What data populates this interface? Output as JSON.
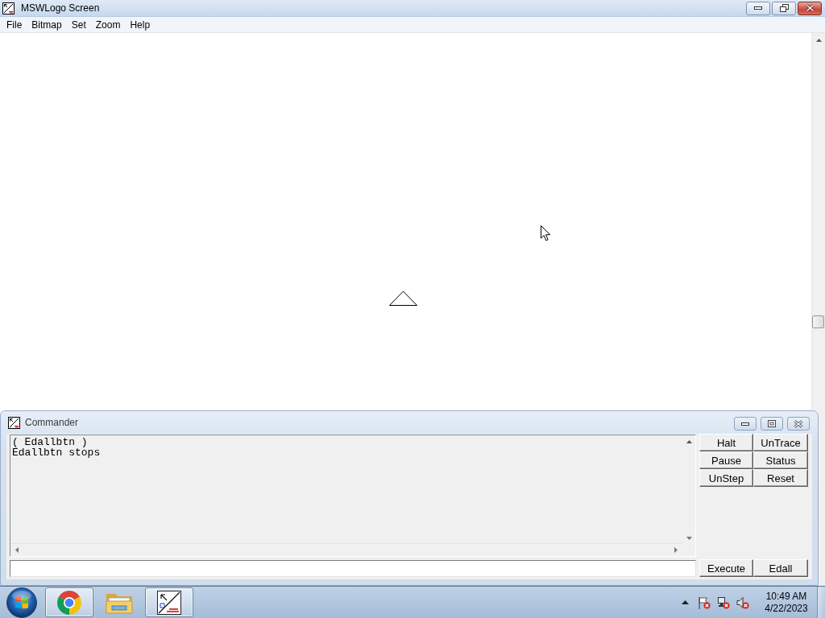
{
  "window": {
    "title": "MSWLogo Screen"
  },
  "menu": [
    "File",
    "Bitmap",
    "Set",
    "Zoom",
    "Help"
  ],
  "commander": {
    "title": "Commander",
    "output": [
      "( Edallbtn )",
      "Edallbtn stops"
    ],
    "buttons": [
      "Halt",
      "UnTrace",
      "Pause",
      "Status",
      "UnStep",
      "Reset"
    ],
    "bottom_buttons": [
      "Execute",
      "Edall"
    ]
  },
  "taskbar": {
    "apps": [
      {
        "kind": "browser",
        "running": true
      },
      {
        "kind": "folder",
        "running": false
      },
      {
        "kind": "logo",
        "running": true
      }
    ],
    "clock": {
      "time": "10:49 AM",
      "date": "4/22/2023"
    }
  }
}
